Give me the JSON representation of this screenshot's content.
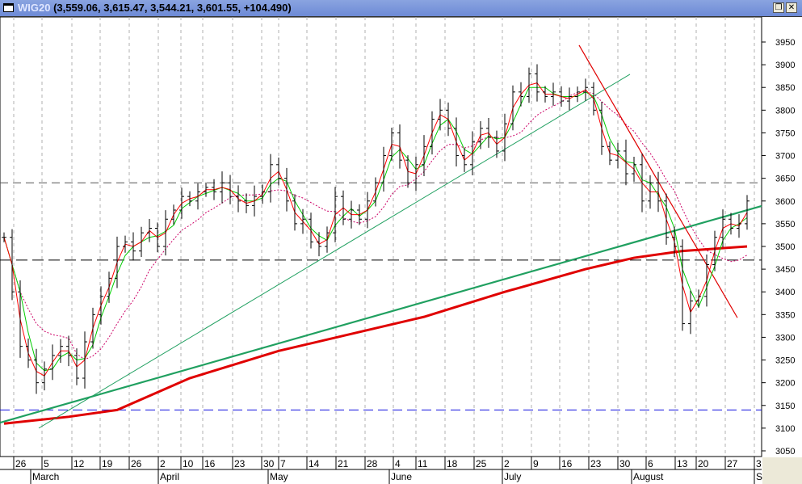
{
  "window": {
    "symbol": "WIG20",
    "ohlc_text": "(3,559.06, 3,615.47, 3,544.21, 3,601.55, +104.490)",
    "restore_icon": "restore-icon",
    "close_icon": "close-icon"
  },
  "chart_data": {
    "type": "ohlc",
    "title": "WIG20",
    "ylim": [
      3030,
      3980
    ],
    "yticks": [
      3950,
      3900,
      3850,
      3800,
      3750,
      3700,
      3650,
      3600,
      3550,
      3500,
      3450,
      3400,
      3350,
      3300,
      3250,
      3200,
      3150,
      3100,
      3050
    ],
    "xweeks": [
      {
        "i": 0.7,
        "l": "26"
      },
      {
        "i": 4.2,
        "l": "5"
      },
      {
        "i": 7.9,
        "l": "12"
      },
      {
        "i": 11.4,
        "l": "19"
      },
      {
        "i": 15,
        "l": "26"
      },
      {
        "i": 18.6,
        "l": "2"
      },
      {
        "i": 21.4,
        "l": "10"
      },
      {
        "i": 24.1,
        "l": "16"
      },
      {
        "i": 27.8,
        "l": "23"
      },
      {
        "i": 31.4,
        "l": "30"
      },
      {
        "i": 33.5,
        "l": "7"
      },
      {
        "i": 37,
        "l": "14"
      },
      {
        "i": 40.6,
        "l": "21"
      },
      {
        "i": 44.2,
        "l": "28"
      },
      {
        "i": 47.7,
        "l": "4"
      },
      {
        "i": 50.5,
        "l": "11"
      },
      {
        "i": 54.1,
        "l": "18"
      },
      {
        "i": 57.7,
        "l": "25"
      },
      {
        "i": 61.2,
        "l": "2"
      },
      {
        "i": 64.8,
        "l": "9"
      },
      {
        "i": 68.3,
        "l": "16"
      },
      {
        "i": 71.9,
        "l": "23"
      },
      {
        "i": 75.5,
        "l": "30"
      },
      {
        "i": 79,
        "l": "6"
      },
      {
        "i": 82.6,
        "l": "13"
      },
      {
        "i": 85.2,
        "l": "20"
      },
      {
        "i": 88.8,
        "l": "27"
      },
      {
        "i": 92.4,
        "l": "3"
      }
    ],
    "xmonths": [
      {
        "i": 2.8,
        "l": "March"
      },
      {
        "i": 18.6,
        "l": "April"
      },
      {
        "i": 32.2,
        "l": "May"
      },
      {
        "i": 47.2,
        "l": "June"
      },
      {
        "i": 61.2,
        "l": "July"
      },
      {
        "i": 77.2,
        "l": "August"
      },
      {
        "i": 92.4,
        "l": "Se"
      }
    ],
    "close": [
      3520,
      3400,
      3280,
      3250,
      3200,
      3230,
      3260,
      3280,
      3260,
      3210,
      3290,
      3350,
      3390,
      3430,
      3500,
      3510,
      3490,
      3530,
      3540,
      3500,
      3560,
      3580,
      3610,
      3600,
      3620,
      3630,
      3620,
      3640,
      3610,
      3600,
      3590,
      3610,
      3620,
      3680,
      3650,
      3600,
      3550,
      3560,
      3510,
      3500,
      3530,
      3610,
      3560,
      3580,
      3560,
      3600,
      3640,
      3700,
      3750,
      3690,
      3640,
      3680,
      3720,
      3780,
      3800,
      3760,
      3700,
      3680,
      3730,
      3760,
      3740,
      3710,
      3770,
      3840,
      3830,
      3880,
      3840,
      3830,
      3840,
      3820,
      3830,
      3840,
      3850,
      3800,
      3720,
      3690,
      3710,
      3660,
      3680,
      3600,
      3640,
      3600,
      3520,
      3500,
      3330,
      3380,
      3390,
      3460,
      3520,
      3560,
      3540,
      3550,
      3600
    ],
    "ma_long": [
      [
        0,
        3110
      ],
      [
        8,
        3125
      ],
      [
        14,
        3140
      ],
      [
        23,
        3210
      ],
      [
        34,
        3270
      ],
      [
        46,
        3320
      ],
      [
        52,
        3345
      ],
      [
        62,
        3400
      ],
      [
        72,
        3450
      ],
      [
        78,
        3475
      ],
      [
        84,
        3490
      ],
      [
        92,
        3500
      ]
    ],
    "hlines": [
      {
        "p": 3640,
        "color": "#555555",
        "dash": "10,6"
      },
      {
        "p": 3470,
        "color": "#000000",
        "dash": "14,6"
      },
      {
        "p": 3140,
        "color": "#1010e0",
        "dash": "12,6"
      }
    ],
    "trendlines": [
      {
        "i1": 4.3,
        "p1": 3100,
        "i2": 77.5,
        "p2": 3879,
        "color": "#20a060",
        "w": 1
      },
      {
        "i1": -0.5,
        "p1": 3112,
        "i2": 93.8,
        "p2": 3589,
        "color": "#20a060",
        "w": 2.2
      },
      {
        "i1": 71.2,
        "p1": 3943,
        "i2": 90.8,
        "p2": 3343,
        "color": "#e00000",
        "w": 1.2
      }
    ],
    "colors": {
      "bars": "#000000",
      "ma_fast": "#ff0000",
      "ma_mid": "#00cc00",
      "ma_slow": "#cc0066",
      "ma_long": "#e00000"
    }
  }
}
